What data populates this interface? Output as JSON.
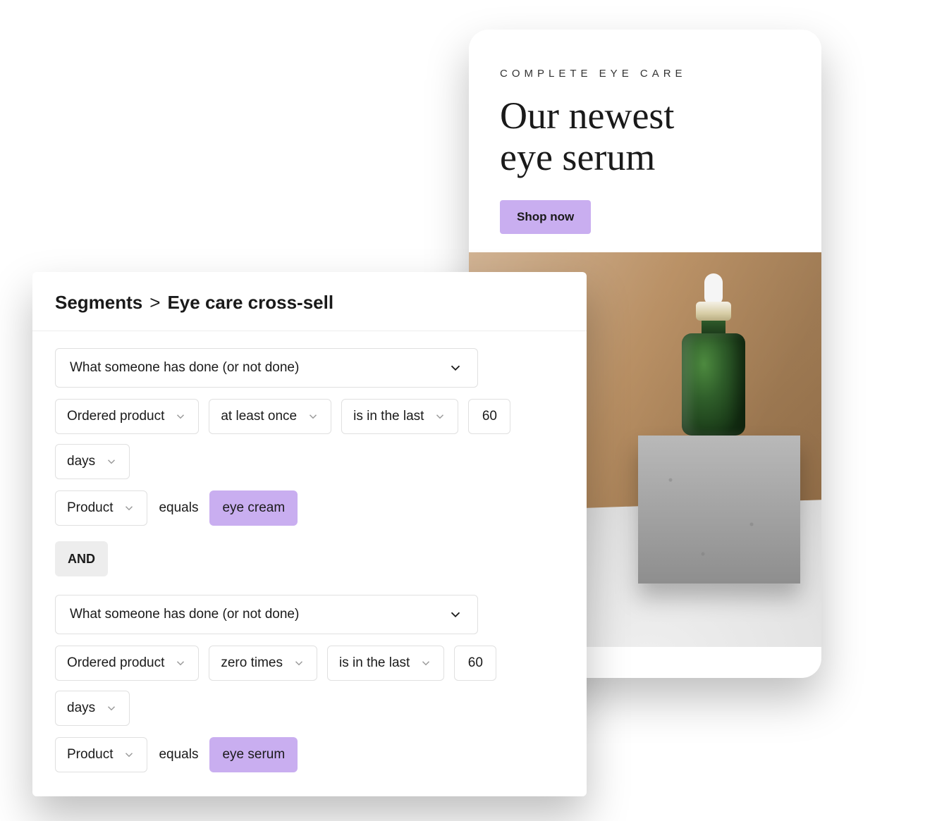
{
  "promo": {
    "eyebrow": "COMPLETE EYE CARE",
    "title_line1": "Our newest",
    "title_line2": "eye serum",
    "cta": "Shop now"
  },
  "segments": {
    "breadcrumb_root": "Segments",
    "breadcrumb_sep": ">",
    "breadcrumb_leaf": "Eye care cross-sell",
    "logic_operator": "AND",
    "block1": {
      "definition_select": "What someone has done (or not done)",
      "metric": "Ordered product",
      "frequency": "at least once",
      "time_relation": "is in the last",
      "time_value": "60",
      "time_unit": "days",
      "property": "Product",
      "operator": "equals",
      "value": "eye cream"
    },
    "block2": {
      "definition_select": "What someone has done (or not done)",
      "metric": "Ordered product",
      "frequency": "zero times",
      "time_relation": "is in the last",
      "time_value": "60",
      "time_unit": "days",
      "property": "Product",
      "operator": "equals",
      "value": "eye serum"
    }
  },
  "colors": {
    "accent_lavender": "#c9aef0"
  }
}
